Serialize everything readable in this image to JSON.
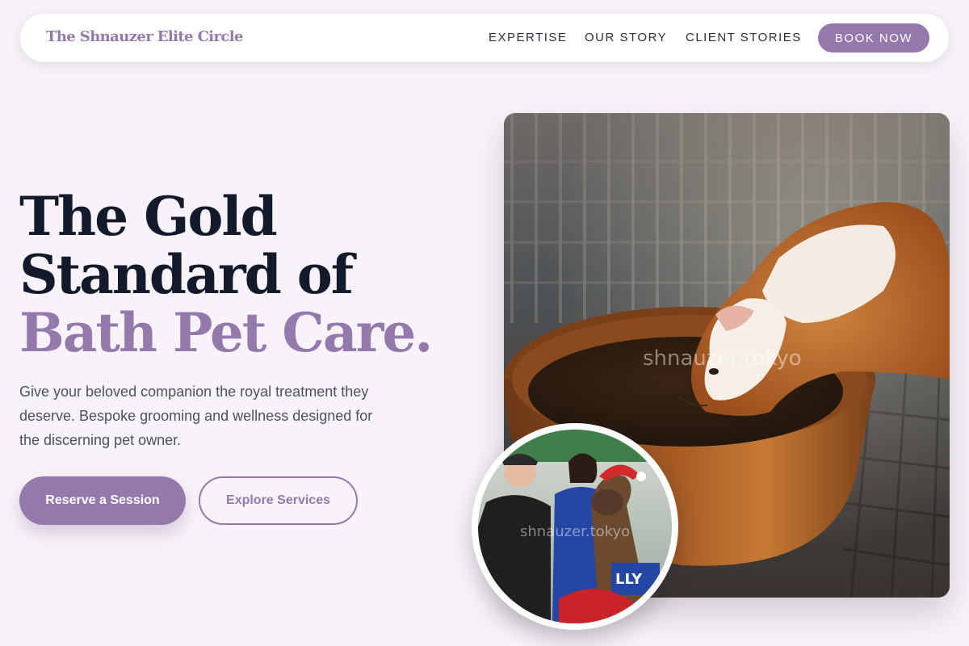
{
  "nav": {
    "brand": "The Shnauzer Elite Circle",
    "links": [
      "EXPERTISE",
      "OUR STORY",
      "CLIENT STORIES"
    ],
    "cta": "BOOK NOW"
  },
  "hero": {
    "title_line1": "The Gold",
    "title_line2": "Standard of",
    "title_accent": "Bath Pet Care.",
    "description": "Give your beloved companion the royal treatment they deserve. Bespoke grooming and wellness designed for the discerning pet owner.",
    "primary_button": "Reserve a Session",
    "secondary_button": "Explore Services"
  },
  "images": {
    "main_watermark": "shnauzer.tokyo",
    "circle_watermark": "shnauzer.tokyo",
    "circle_sign": "LLY"
  },
  "colors": {
    "accent": "#9479ad",
    "background": "#f8f3f8",
    "heading": "#131a2c"
  }
}
